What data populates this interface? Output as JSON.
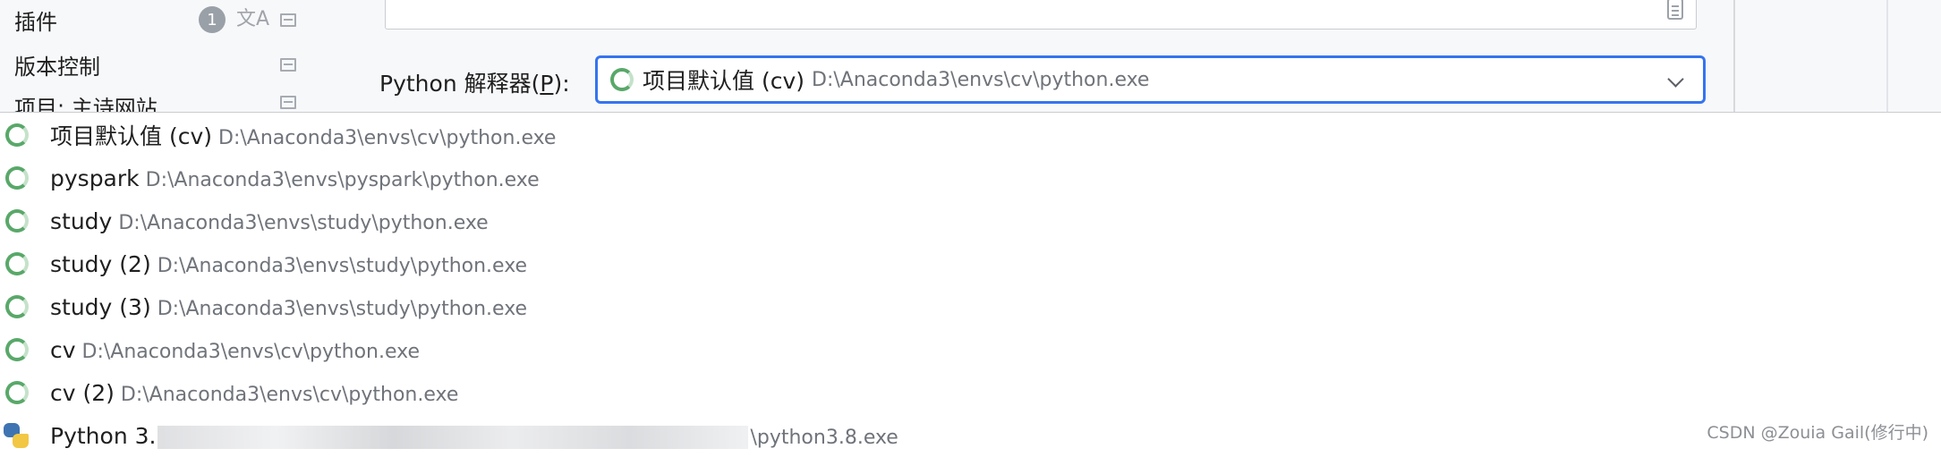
{
  "sidebar": {
    "items": [
      {
        "label": "插件",
        "badge": "1",
        "icons": [
          "translate-icon",
          "project-scope-icon"
        ]
      },
      {
        "label": "版本控制",
        "icons": [
          "project-scope-icon"
        ]
      },
      {
        "label": "项目: 主诗网站",
        "icons": [
          "project-scope-icon"
        ]
      }
    ]
  },
  "interpreter": {
    "label_prefix": "Python 解释器(",
    "label_mnemonic": "P",
    "label_suffix": "):",
    "selected_name": "项目默认值 (cv)",
    "selected_path": "D:\\Anaconda3\\envs\\cv\\python.exe"
  },
  "dropdown": {
    "options": [
      {
        "name": "项目默认值 (cv)",
        "path": "D:\\Anaconda3\\envs\\cv\\python.exe",
        "icon": "conda-env-icon"
      },
      {
        "name": "pyspark",
        "path": "D:\\Anaconda3\\envs\\pyspark\\python.exe",
        "icon": "conda-env-icon"
      },
      {
        "name": "study",
        "path": "D:\\Anaconda3\\envs\\study\\python.exe",
        "icon": "conda-env-icon"
      },
      {
        "name": "study (2)",
        "path": "D:\\Anaconda3\\envs\\study\\python.exe",
        "icon": "conda-env-icon"
      },
      {
        "name": "study (3)",
        "path": "D:\\Anaconda3\\envs\\study\\python.exe",
        "icon": "conda-env-icon"
      },
      {
        "name": "cv",
        "path": "D:\\Anaconda3\\envs\\cv\\python.exe",
        "icon": "conda-env-icon"
      },
      {
        "name": "cv (2)",
        "path": "D:\\Anaconda3\\envs\\cv\\python.exe",
        "icon": "conda-env-icon"
      },
      {
        "name": "Python 3.",
        "path": "\\python3.8.exe",
        "icon": "python-logo-icon"
      }
    ]
  },
  "watermark": "CSDN @Zouia  Gail(修行中)",
  "colors": {
    "accent": "#3574f0",
    "env_icon": "#59a869",
    "path_text": "#6f737a"
  }
}
